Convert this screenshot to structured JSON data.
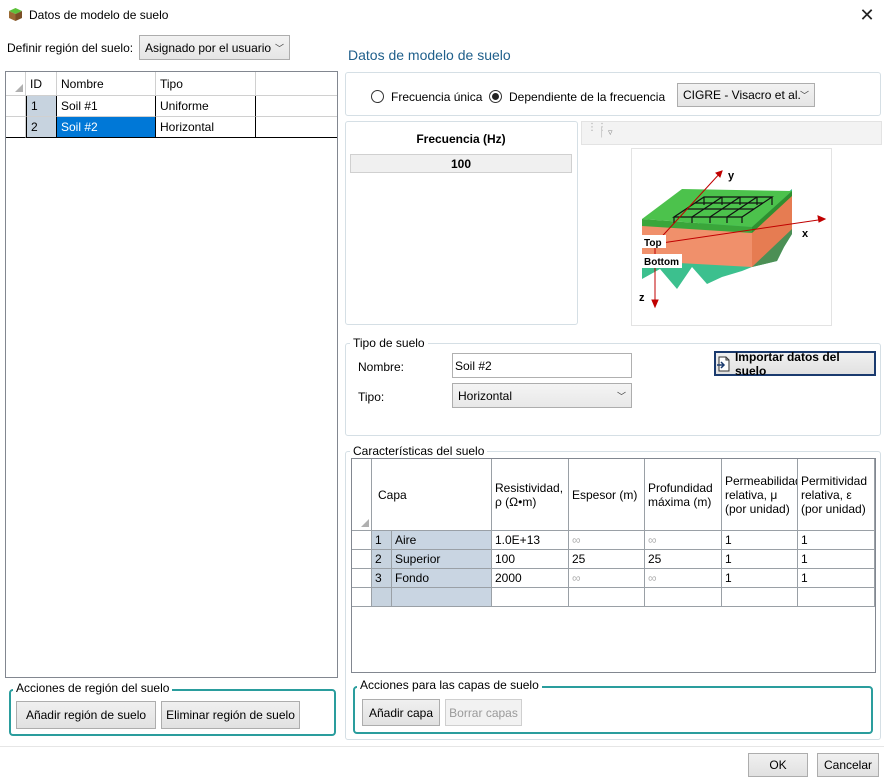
{
  "window": {
    "title": "Datos de modelo de suelo",
    "close_glyph": "✕"
  },
  "region_selector": {
    "label": "Definir región del suelo:",
    "value": "Asignado por el usuario"
  },
  "regions_table": {
    "columns": [
      "ID",
      "Nombre",
      "Tipo"
    ],
    "rows": [
      {
        "id": "1",
        "name": "Soil #1",
        "type": "Uniforme"
      },
      {
        "id": "2",
        "name": "Soil #2",
        "type": "Horizontal"
      }
    ],
    "selected_row": 1,
    "selection_color": "#0078d7"
  },
  "region_actions": {
    "legend": "Acciones de región del suelo",
    "add_label": "Añadir región de suelo",
    "remove_label": "Eliminar región de suelo"
  },
  "model": {
    "heading": "Datos de modelo de suelo",
    "heading_color": "#1f5f8b",
    "radio_single": "Frecuencia única",
    "radio_dependent": "Dependiente de la frecuencia",
    "selected_mode": "dependent",
    "method_value": "CIGRE - Visacro et al."
  },
  "frequency": {
    "header": "Frecuencia (Hz)",
    "value": "100"
  },
  "diagram": {
    "axis_x": "x",
    "axis_y": "y",
    "axis_z": "z",
    "label_top": "Top",
    "label_bottom": "Bottom"
  },
  "soil_type": {
    "legend": "Tipo de suelo",
    "name_label": "Nombre:",
    "name_value": "Soil #2",
    "type_label": "Tipo:",
    "type_value": "Horizontal",
    "import_label": "Importar datos del suelo"
  },
  "characteristics": {
    "legend": "Características del suelo",
    "columns": [
      "Capa",
      "Resistividad, ρ (Ω•m)",
      "Espesor (m)",
      "Profundidad máxima (m)",
      "Permeabilidad relativa, μ (por unidad)",
      "Permitividad relativa, ε (por unidad)"
    ],
    "rows": [
      {
        "n": "1",
        "layer": "Aire",
        "res": "1.0E+13",
        "thick": "∞",
        "depth": "∞",
        "mu": "1",
        "eps": "1"
      },
      {
        "n": "2",
        "layer": "Superior",
        "res": "100",
        "thick": "25",
        "depth": "25",
        "mu": "1",
        "eps": "1"
      },
      {
        "n": "3",
        "layer": "Fondo",
        "res": "2000",
        "thick": "∞",
        "depth": "∞",
        "mu": "1",
        "eps": "1"
      }
    ]
  },
  "layer_actions": {
    "legend": "Acciones para las capas de suelo",
    "add_label": "Añadir capa",
    "clear_label": "Borrar capas"
  },
  "footer": {
    "ok_label": "OK",
    "cancel_label": "Cancelar"
  },
  "colors": {
    "teal_frame": "#2a9d9d",
    "soil_orange": "#f0906b",
    "grass_green": "#4cc24c",
    "bedrock_teal": "#3cc08e"
  }
}
